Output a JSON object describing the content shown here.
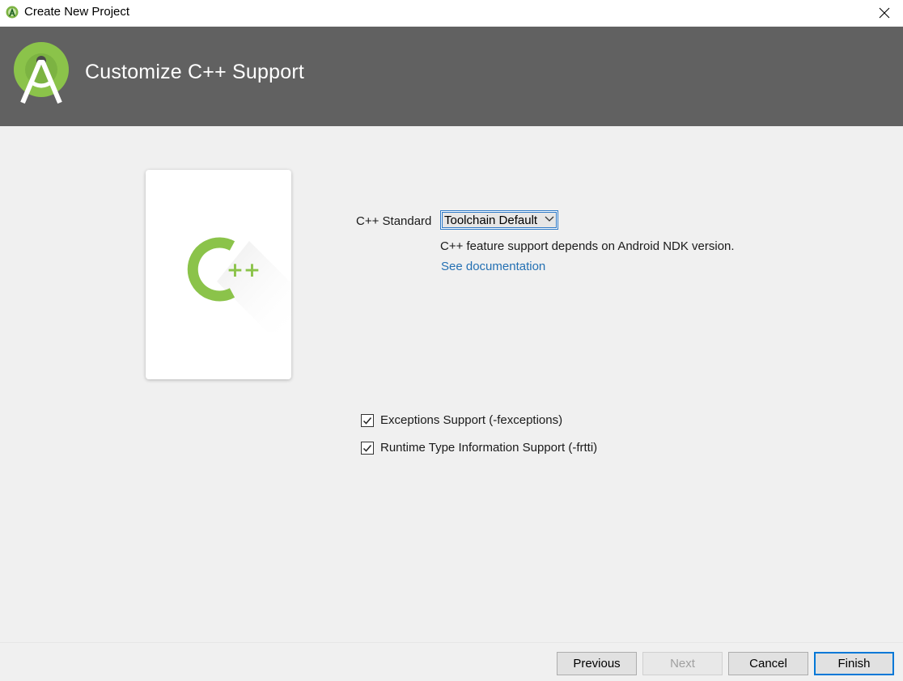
{
  "window": {
    "title": "Create New Project"
  },
  "banner": {
    "heading": "Customize C++ Support"
  },
  "form": {
    "cpp_standard_label": "C++ Standard",
    "cpp_standard_value": "Toolchain Default",
    "hint": "C++ feature support depends on Android NDK version.",
    "doc_link": "See documentation",
    "checkboxes": [
      {
        "label": "Exceptions Support (-fexceptions)",
        "checked": true
      },
      {
        "label": "Runtime Type Information Support (-frtti)",
        "checked": true
      }
    ]
  },
  "footer": {
    "previous": "Previous",
    "next": "Next",
    "cancel": "Cancel",
    "finish": "Finish"
  },
  "card": {
    "logo_text": "++"
  },
  "colors": {
    "banner": "#616161",
    "android_green": "#8bc34a",
    "link": "#2470b3",
    "focus_blue": "#0078d7"
  },
  "icons": {
    "app": "android-studio-icon",
    "close": "close-icon",
    "dropdown": "chevron-down-icon",
    "check": "checkmark-icon"
  }
}
